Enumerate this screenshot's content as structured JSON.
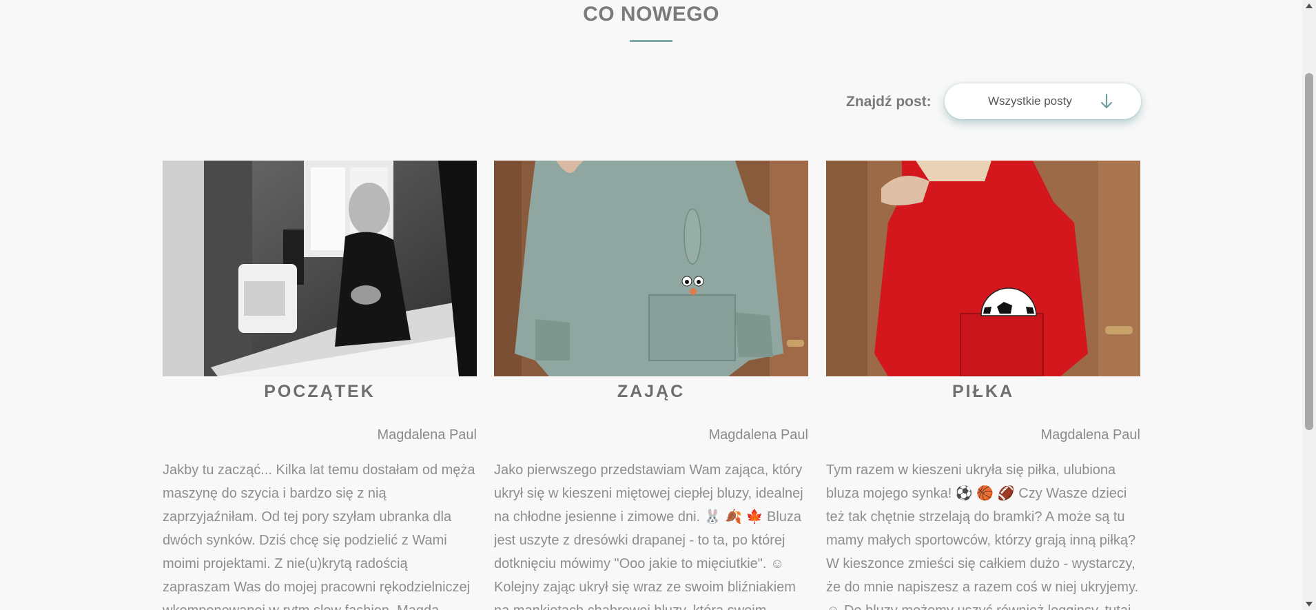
{
  "section": {
    "title": "CO NOWEGO"
  },
  "filter": {
    "label": "Znajdź post:",
    "selected": "Wszystkie posty",
    "icon": "arrow-down-icon"
  },
  "colors": {
    "accent": "#7fa9a9",
    "text_muted": "#8e8e8e",
    "title_gray": "#7a7a7a"
  },
  "posts": [
    {
      "title": "POCZĄTEK",
      "author": "Magdalena Paul",
      "excerpt": "Jakby tu zacząć... Kilka lat temu dostałam od męża maszynę do szycia i bardzo się z nią zaprzyjaźniłam. Od tej pory szyłam ubranka dla dwóch synków. Dziś chcę się podzielić z Wami moimi projektami. Z nie(u)krytą radością zapraszam Was do mojej pracowni rękodzielniczej wkomponowanej w rytm slow fashion. Magda",
      "image": "black-and-white photo of a woman sewing at a sewing machine"
    },
    {
      "title": "ZAJĄC",
      "author": "Magdalena Paul",
      "excerpt": "Jako pierwszego przedstawiam Wam zająca, który ukrył się w kieszeni miętowej ciepłej bluzy, idealnej na chłodne jesienne i zimowe dni. 🐰 🍂 🍁 Bluza jest uszyte z dresówki drapanej - to ta, po której dotknięciu mówimy \"Ooo jakie to mięciutkie\". ☺ Kolejny zając ukrył się wraz ze swoim bliźniakiem na mankietach chabrowej bluzy, która swoim",
      "image": "mint hoodie with a bunny peeking out of the pocket"
    },
    {
      "title": "PIŁKA",
      "author": "Magdalena Paul",
      "excerpt": "Tym razem w kieszeni ukryła się piłka, ulubiona bluza mojego synka! ⚽ 🏀 🏈 Czy Wasze dzieci też tak chętnie strzelają do bramki? A może są tu mamy małych sportowców, którzy grają inną piłką? W kieszonce zmieści się całkiem dużo - wystarczy, że do mnie napiszesz a razem coś w niej ukryjemy. ☺ Do bluzy możemy uszyć również legginsy, tutaj",
      "image": "red hoodie with a soccer ball in the pocket"
    }
  ]
}
